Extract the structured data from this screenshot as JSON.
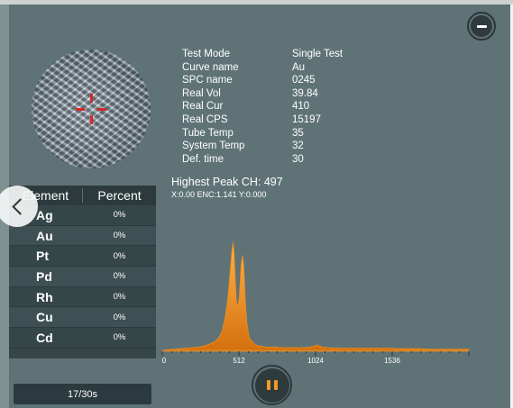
{
  "params": [
    {
      "label": "Test Mode",
      "value": "Single Test"
    },
    {
      "label": "Curve name",
      "value": "Au"
    },
    {
      "label": "SPC name",
      "value": "0245"
    },
    {
      "label": "Real Vol",
      "value": "39.84"
    },
    {
      "label": "Real Cur",
      "value": "410"
    },
    {
      "label": "Real CPS",
      "value": "15197"
    },
    {
      "label": "Tube Temp",
      "value": "35"
    },
    {
      "label": "System Temp",
      "value": "32"
    },
    {
      "label": "Def. time",
      "value": "30"
    }
  ],
  "peak_text": "Highest Peak CH: 497",
  "coords_text": "X:0.00 ENC:1.141 Y:0.000",
  "table": {
    "header_element": "Element",
    "header_percent": "Percent",
    "rows": [
      {
        "element": "Ag",
        "percent": "0%"
      },
      {
        "element": "Au",
        "percent": "0%"
      },
      {
        "element": "Pt",
        "percent": "0%"
      },
      {
        "element": "Pd",
        "percent": "0%"
      },
      {
        "element": "Rh",
        "percent": "0%"
      },
      {
        "element": "Cu",
        "percent": "0%"
      },
      {
        "element": "Cd",
        "percent": "0%"
      }
    ]
  },
  "progress_text": "17/30s",
  "icons": {
    "minimize": "minimize-icon",
    "back": "chevron-left-icon",
    "pause": "pause-icon",
    "target": "crosshair-icon"
  },
  "colors": {
    "background": "#5f7376",
    "spectrum": "#f08c1a",
    "table_header": "#2c3a3d"
  },
  "spectrum": {
    "x_ticks": [
      "0",
      "512",
      "1024",
      "1536"
    ],
    "x_tick_values": [
      0,
      512,
      1024,
      1536
    ],
    "x_max": 2048,
    "points": [
      [
        0,
        0
      ],
      [
        40,
        0.5
      ],
      [
        80,
        1
      ],
      [
        120,
        1.5
      ],
      [
        160,
        2
      ],
      [
        200,
        2.5
      ],
      [
        240,
        3
      ],
      [
        280,
        4
      ],
      [
        320,
        6
      ],
      [
        350,
        8
      ],
      [
        380,
        12
      ],
      [
        400,
        18
      ],
      [
        420,
        30
      ],
      [
        440,
        50
      ],
      [
        455,
        75
      ],
      [
        465,
        92
      ],
      [
        472,
        100
      ],
      [
        480,
        90
      ],
      [
        488,
        65
      ],
      [
        495,
        45
      ],
      [
        505,
        40
      ],
      [
        515,
        50
      ],
      [
        527,
        80
      ],
      [
        537,
        88
      ],
      [
        545,
        76
      ],
      [
        555,
        45
      ],
      [
        565,
        25
      ],
      [
        580,
        12
      ],
      [
        600,
        8
      ],
      [
        625,
        5
      ],
      [
        650,
        4
      ],
      [
        700,
        3
      ],
      [
        750,
        3
      ],
      [
        800,
        2.5
      ],
      [
        850,
        2.5
      ],
      [
        900,
        2.5
      ],
      [
        950,
        2.5
      ],
      [
        980,
        3
      ],
      [
        1010,
        3.5
      ],
      [
        1030,
        5
      ],
      [
        1050,
        4
      ],
      [
        1070,
        3
      ],
      [
        1100,
        2.5
      ],
      [
        1200,
        2
      ],
      [
        1300,
        2
      ],
      [
        1400,
        2
      ],
      [
        1500,
        2
      ],
      [
        1600,
        1.5
      ],
      [
        1700,
        1.5
      ],
      [
        1800,
        1
      ],
      [
        1900,
        1
      ],
      [
        2048,
        1
      ]
    ]
  }
}
